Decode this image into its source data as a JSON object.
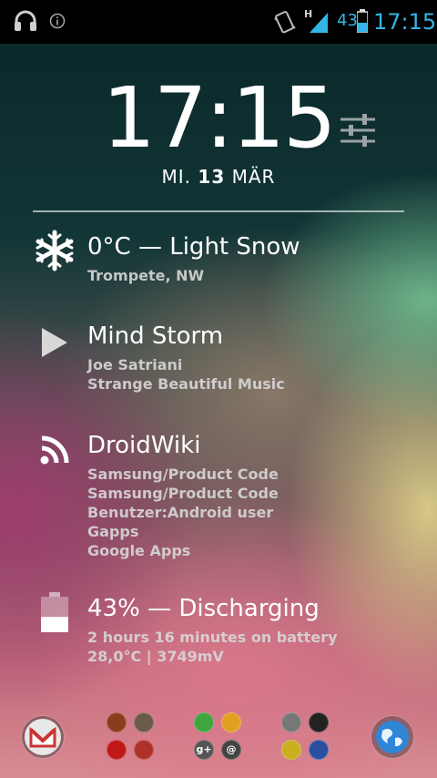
{
  "status_bar": {
    "network_type": "H",
    "battery_percent": "43",
    "time": "17:15",
    "icons": [
      "headphones-icon",
      "info-icon",
      "vibrate-icon",
      "signal-icon",
      "battery-icon"
    ]
  },
  "clock": {
    "time": "17:15",
    "weekday": "MI.",
    "day": "13",
    "month": "MÄR"
  },
  "weather": {
    "title": "0°C — Light Snow",
    "location": "Trompete, NW",
    "icon": "snowflake-icon"
  },
  "music": {
    "title": "Mind Storm",
    "artist": "Joe Satriani",
    "album": "Strange Beautiful Music",
    "icon": "play-icon"
  },
  "feed": {
    "title": "DroidWiki",
    "items": [
      "Samsung/Product Code",
      "Samsung/Product Code",
      "Benutzer:Android user",
      "Gapps",
      "Google Apps"
    ],
    "icon": "rss-icon"
  },
  "battery": {
    "title": "43% — Discharging",
    "detail1": "2 hours 16 minutes on battery",
    "detail2": "28,0°C | 3749mV",
    "level": 0.43
  },
  "dock": {
    "left_app": "gmail-icon",
    "right_app": "browser-globe-icon",
    "folders": [
      [
        "game-icon-1",
        "game-icon-2",
        "game-icon-3",
        "pen-icon"
      ],
      [
        "whatsapp-icon",
        "photos-icon",
        "google-plus-icon",
        "email-icon"
      ],
      [
        "messaging-icon",
        "night-mode-icon",
        "beetle-icon",
        "tshirt-icon"
      ]
    ],
    "labels": {
      "google_plus": "g+",
      "email": "@"
    }
  }
}
